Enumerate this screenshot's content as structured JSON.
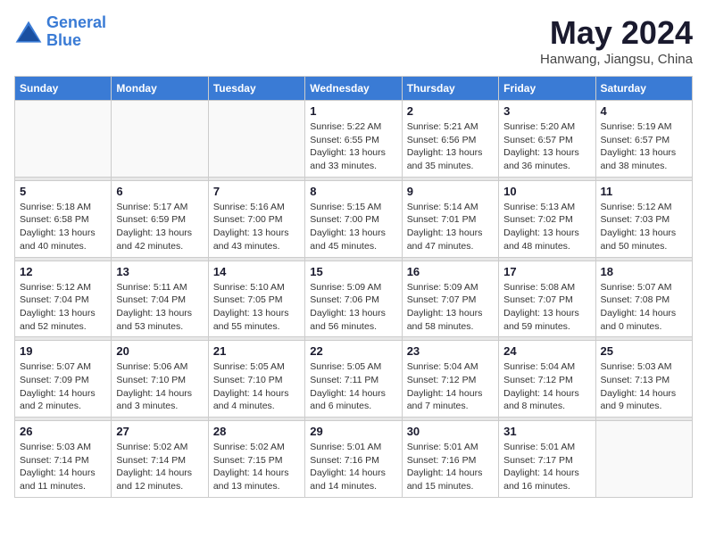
{
  "logo": {
    "line1": "General",
    "line2": "Blue"
  },
  "title": "May 2024",
  "location": "Hanwang, Jiangsu, China",
  "weekdays": [
    "Sunday",
    "Monday",
    "Tuesday",
    "Wednesday",
    "Thursday",
    "Friday",
    "Saturday"
  ],
  "weeks": [
    [
      {
        "day": "",
        "sunrise": "",
        "sunset": "",
        "daylight": ""
      },
      {
        "day": "",
        "sunrise": "",
        "sunset": "",
        "daylight": ""
      },
      {
        "day": "",
        "sunrise": "",
        "sunset": "",
        "daylight": ""
      },
      {
        "day": "1",
        "sunrise": "Sunrise: 5:22 AM",
        "sunset": "Sunset: 6:55 PM",
        "daylight": "Daylight: 13 hours and 33 minutes."
      },
      {
        "day": "2",
        "sunrise": "Sunrise: 5:21 AM",
        "sunset": "Sunset: 6:56 PM",
        "daylight": "Daylight: 13 hours and 35 minutes."
      },
      {
        "day": "3",
        "sunrise": "Sunrise: 5:20 AM",
        "sunset": "Sunset: 6:57 PM",
        "daylight": "Daylight: 13 hours and 36 minutes."
      },
      {
        "day": "4",
        "sunrise": "Sunrise: 5:19 AM",
        "sunset": "Sunset: 6:57 PM",
        "daylight": "Daylight: 13 hours and 38 minutes."
      }
    ],
    [
      {
        "day": "5",
        "sunrise": "Sunrise: 5:18 AM",
        "sunset": "Sunset: 6:58 PM",
        "daylight": "Daylight: 13 hours and 40 minutes."
      },
      {
        "day": "6",
        "sunrise": "Sunrise: 5:17 AM",
        "sunset": "Sunset: 6:59 PM",
        "daylight": "Daylight: 13 hours and 42 minutes."
      },
      {
        "day": "7",
        "sunrise": "Sunrise: 5:16 AM",
        "sunset": "Sunset: 7:00 PM",
        "daylight": "Daylight: 13 hours and 43 minutes."
      },
      {
        "day": "8",
        "sunrise": "Sunrise: 5:15 AM",
        "sunset": "Sunset: 7:00 PM",
        "daylight": "Daylight: 13 hours and 45 minutes."
      },
      {
        "day": "9",
        "sunrise": "Sunrise: 5:14 AM",
        "sunset": "Sunset: 7:01 PM",
        "daylight": "Daylight: 13 hours and 47 minutes."
      },
      {
        "day": "10",
        "sunrise": "Sunrise: 5:13 AM",
        "sunset": "Sunset: 7:02 PM",
        "daylight": "Daylight: 13 hours and 48 minutes."
      },
      {
        "day": "11",
        "sunrise": "Sunrise: 5:12 AM",
        "sunset": "Sunset: 7:03 PM",
        "daylight": "Daylight: 13 hours and 50 minutes."
      }
    ],
    [
      {
        "day": "12",
        "sunrise": "Sunrise: 5:12 AM",
        "sunset": "Sunset: 7:04 PM",
        "daylight": "Daylight: 13 hours and 52 minutes."
      },
      {
        "day": "13",
        "sunrise": "Sunrise: 5:11 AM",
        "sunset": "Sunset: 7:04 PM",
        "daylight": "Daylight: 13 hours and 53 minutes."
      },
      {
        "day": "14",
        "sunrise": "Sunrise: 5:10 AM",
        "sunset": "Sunset: 7:05 PM",
        "daylight": "Daylight: 13 hours and 55 minutes."
      },
      {
        "day": "15",
        "sunrise": "Sunrise: 5:09 AM",
        "sunset": "Sunset: 7:06 PM",
        "daylight": "Daylight: 13 hours and 56 minutes."
      },
      {
        "day": "16",
        "sunrise": "Sunrise: 5:09 AM",
        "sunset": "Sunset: 7:07 PM",
        "daylight": "Daylight: 13 hours and 58 minutes."
      },
      {
        "day": "17",
        "sunrise": "Sunrise: 5:08 AM",
        "sunset": "Sunset: 7:07 PM",
        "daylight": "Daylight: 13 hours and 59 minutes."
      },
      {
        "day": "18",
        "sunrise": "Sunrise: 5:07 AM",
        "sunset": "Sunset: 7:08 PM",
        "daylight": "Daylight: 14 hours and 0 minutes."
      }
    ],
    [
      {
        "day": "19",
        "sunrise": "Sunrise: 5:07 AM",
        "sunset": "Sunset: 7:09 PM",
        "daylight": "Daylight: 14 hours and 2 minutes."
      },
      {
        "day": "20",
        "sunrise": "Sunrise: 5:06 AM",
        "sunset": "Sunset: 7:10 PM",
        "daylight": "Daylight: 14 hours and 3 minutes."
      },
      {
        "day": "21",
        "sunrise": "Sunrise: 5:05 AM",
        "sunset": "Sunset: 7:10 PM",
        "daylight": "Daylight: 14 hours and 4 minutes."
      },
      {
        "day": "22",
        "sunrise": "Sunrise: 5:05 AM",
        "sunset": "Sunset: 7:11 PM",
        "daylight": "Daylight: 14 hours and 6 minutes."
      },
      {
        "day": "23",
        "sunrise": "Sunrise: 5:04 AM",
        "sunset": "Sunset: 7:12 PM",
        "daylight": "Daylight: 14 hours and 7 minutes."
      },
      {
        "day": "24",
        "sunrise": "Sunrise: 5:04 AM",
        "sunset": "Sunset: 7:12 PM",
        "daylight": "Daylight: 14 hours and 8 minutes."
      },
      {
        "day": "25",
        "sunrise": "Sunrise: 5:03 AM",
        "sunset": "Sunset: 7:13 PM",
        "daylight": "Daylight: 14 hours and 9 minutes."
      }
    ],
    [
      {
        "day": "26",
        "sunrise": "Sunrise: 5:03 AM",
        "sunset": "Sunset: 7:14 PM",
        "daylight": "Daylight: 14 hours and 11 minutes."
      },
      {
        "day": "27",
        "sunrise": "Sunrise: 5:02 AM",
        "sunset": "Sunset: 7:14 PM",
        "daylight": "Daylight: 14 hours and 12 minutes."
      },
      {
        "day": "28",
        "sunrise": "Sunrise: 5:02 AM",
        "sunset": "Sunset: 7:15 PM",
        "daylight": "Daylight: 14 hours and 13 minutes."
      },
      {
        "day": "29",
        "sunrise": "Sunrise: 5:01 AM",
        "sunset": "Sunset: 7:16 PM",
        "daylight": "Daylight: 14 hours and 14 minutes."
      },
      {
        "day": "30",
        "sunrise": "Sunrise: 5:01 AM",
        "sunset": "Sunset: 7:16 PM",
        "daylight": "Daylight: 14 hours and 15 minutes."
      },
      {
        "day": "31",
        "sunrise": "Sunrise: 5:01 AM",
        "sunset": "Sunset: 7:17 PM",
        "daylight": "Daylight: 14 hours and 16 minutes."
      },
      {
        "day": "",
        "sunrise": "",
        "sunset": "",
        "daylight": ""
      }
    ]
  ]
}
